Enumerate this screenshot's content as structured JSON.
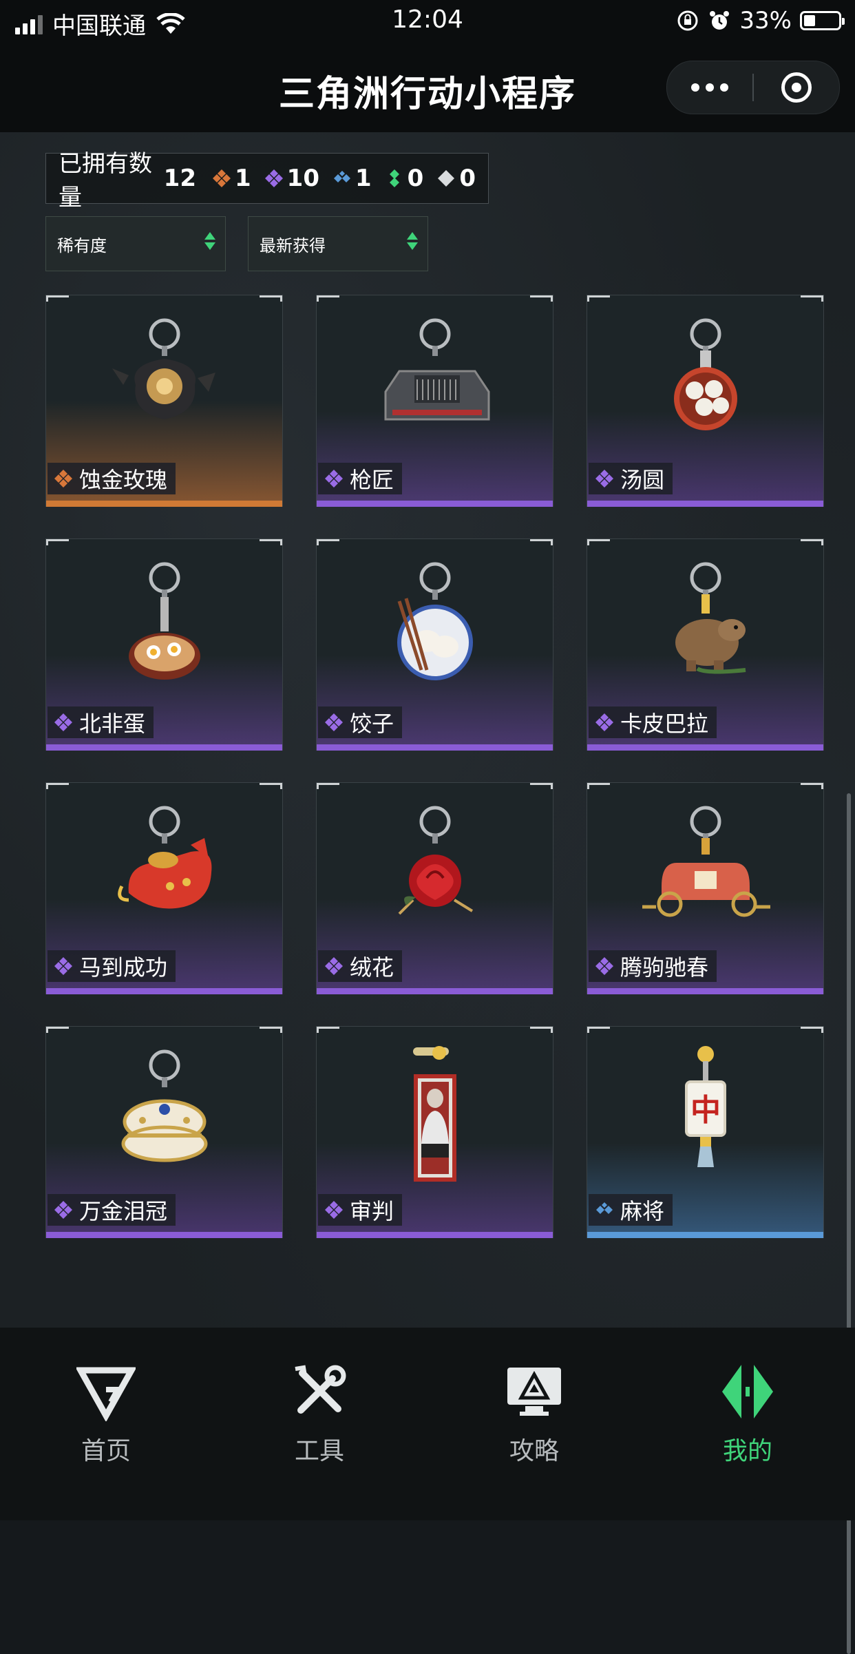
{
  "status_bar": {
    "carrier": "中国联通",
    "time": "12:04",
    "battery": "33%",
    "battery_level": 0.33
  },
  "nav": {
    "title": "三角洲行动小程序"
  },
  "summary": {
    "owned_label": "已拥有数量",
    "owned_total": "12",
    "rarity_counts": [
      {
        "rarity": "orange",
        "count": "1"
      },
      {
        "rarity": "purple",
        "count": "10"
      },
      {
        "rarity": "blue",
        "count": "1"
      },
      {
        "rarity": "green",
        "count": "0"
      },
      {
        "rarity": "white",
        "count": "0"
      }
    ]
  },
  "filters": {
    "rarity_sort": "稀有度",
    "time_sort": "最新获得"
  },
  "items": [
    {
      "name": "蚀金玫瑰",
      "rarity": "orange",
      "icon": "black-rose-teapot-keychain"
    },
    {
      "name": "枪匠",
      "rarity": "purple",
      "icon": "gun-case-keychain"
    },
    {
      "name": "汤圆",
      "rarity": "purple",
      "icon": "tangyuan-pan-keychain"
    },
    {
      "name": "北非蛋",
      "rarity": "purple",
      "icon": "shakshuka-pan-keychain"
    },
    {
      "name": "饺子",
      "rarity": "purple",
      "icon": "dumpling-plate-keychain"
    },
    {
      "name": "卡皮巴拉",
      "rarity": "purple",
      "icon": "capybara-keychain"
    },
    {
      "name": "马到成功",
      "rarity": "purple",
      "icon": "red-horse-keychain"
    },
    {
      "name": "绒花",
      "rarity": "purple",
      "icon": "red-rose-keychain"
    },
    {
      "name": "腾驹驰春",
      "rarity": "purple",
      "icon": "carriage-keychain"
    },
    {
      "name": "万金泪冠",
      "rarity": "purple",
      "icon": "jeweled-egg-keychain"
    },
    {
      "name": "审判",
      "rarity": "purple",
      "icon": "judgement-card-keychain"
    },
    {
      "name": "麻将",
      "rarity": "blue",
      "icon": "mahjong-tile-keychain"
    }
  ],
  "tabbar": [
    {
      "label": "首页",
      "icon": "home-g-icon",
      "active": false
    },
    {
      "label": "工具",
      "icon": "tools-icon",
      "active": false
    },
    {
      "label": "攻略",
      "icon": "guide-monitor-icon",
      "active": false
    },
    {
      "label": "我的",
      "icon": "profile-diamond-icon",
      "active": true
    }
  ],
  "colors": {
    "orange": "#d8773a",
    "purple": "#9a6ce6",
    "blue": "#5a9ad8",
    "green": "#3fd47a",
    "white": "#d9dcde",
    "accent": "#3fd47a"
  }
}
